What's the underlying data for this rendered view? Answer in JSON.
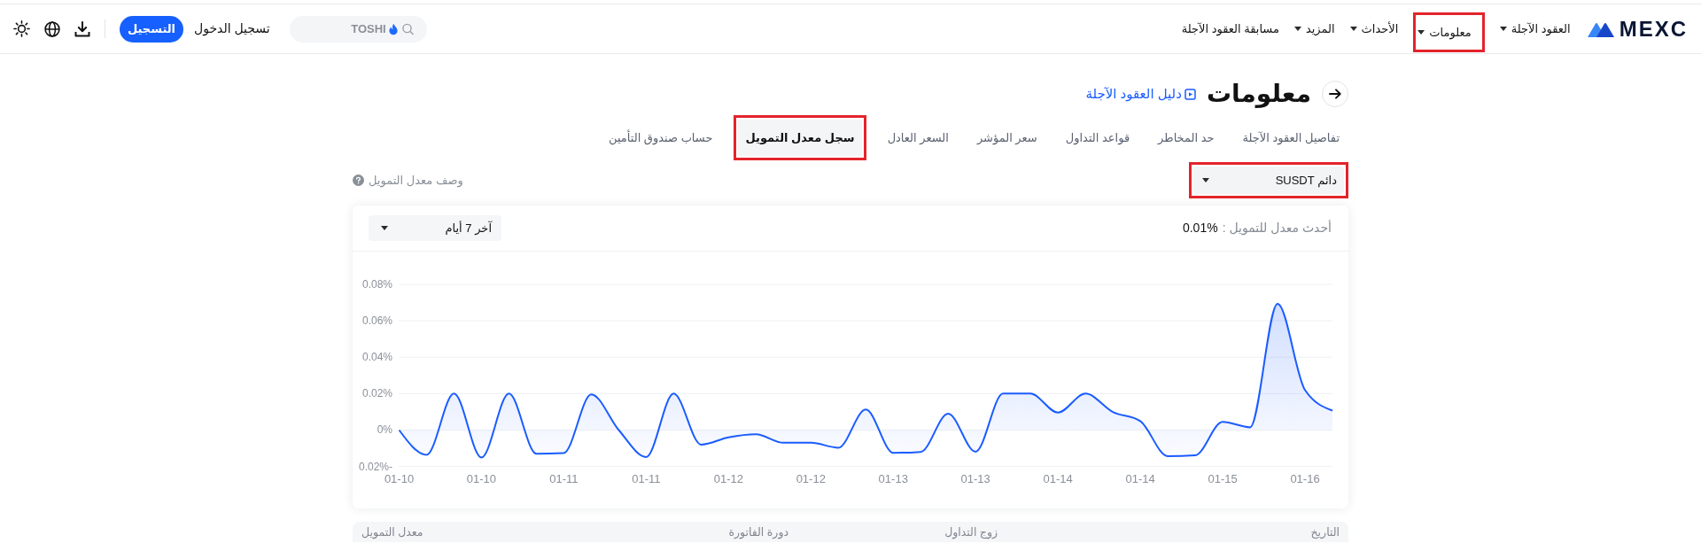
{
  "header": {
    "brand": "MEXC",
    "nav": [
      {
        "label": "العقود الآجلة",
        "has_menu": true,
        "highlighted": false
      },
      {
        "label": "معلومات",
        "has_menu": true,
        "highlighted": true
      },
      {
        "label": "الأحداث",
        "has_menu": true,
        "highlighted": false
      },
      {
        "label": "المزيد",
        "has_menu": true,
        "highlighted": false
      },
      {
        "label": "مسابقة العقود الآجلة",
        "has_menu": false,
        "highlighted": false
      }
    ],
    "search": {
      "placeholder": "TOSHI"
    },
    "login": "تسجيل الدخول",
    "register": "التسجيل"
  },
  "page": {
    "title": "معلومات",
    "guide_link": "دليل العقود الآجلة"
  },
  "tabs": [
    {
      "label": "تفاصيل العقود الآجلة",
      "selected": false,
      "highlighted": false
    },
    {
      "label": "حد المخاطر",
      "selected": false,
      "highlighted": false
    },
    {
      "label": "قواعد التداول",
      "selected": false,
      "highlighted": false
    },
    {
      "label": "سعر المؤشر",
      "selected": false,
      "highlighted": false
    },
    {
      "label": "السعر العادل",
      "selected": false,
      "highlighted": false
    },
    {
      "label": "سجل معدل التمويل",
      "selected": true,
      "highlighted": true
    },
    {
      "label": "حساب صندوق التأمين",
      "selected": false,
      "highlighted": false
    }
  ],
  "contract_select": {
    "value": "دائم SUSDT",
    "highlighted": true
  },
  "funding_description_link": "وصف معدل التمويل",
  "chart_card": {
    "latest_label": "أحدث معدل للتمويل :",
    "latest_value": "0.01%",
    "period_select": "آخر 7 أيام",
    "chart_data": {
      "type": "area",
      "grid": true,
      "categories": [
        "01-10",
        null,
        null,
        "01-10",
        null,
        null,
        "01-11",
        null,
        null,
        "01-11",
        null,
        null,
        "01-12",
        null,
        null,
        "01-12",
        null,
        null,
        "01-13",
        null,
        null,
        "01-13",
        null,
        null,
        "01-14",
        null,
        null,
        "01-14",
        null,
        null,
        "01-15",
        null,
        null,
        "01-16",
        null
      ],
      "ylim": [
        -0.02,
        0.08
      ],
      "yticks": [
        {
          "value": -0.02,
          "label": "-0.02%"
        },
        {
          "value": 0,
          "label": "0%"
        },
        {
          "value": 0.02,
          "label": "0.02%"
        },
        {
          "value": 0.04,
          "label": "0.04%"
        },
        {
          "value": 0.06,
          "label": "0.06%"
        },
        {
          "value": 0.08,
          "label": "0.08%"
        }
      ],
      "series": [
        {
          "color": "#1b5cff",
          "values": [
            0,
            -0.0136,
            0.02,
            -0.0151,
            0.02,
            -0.013,
            -0.0126,
            0.0196,
            0,
            -0.0148,
            0.02,
            -0.008,
            -0.004,
            -0.0023,
            -0.007,
            -0.007,
            -0.0097,
            0.0113,
            -0.0125,
            -0.012,
            0.009,
            -0.0119,
            0.02,
            0.02,
            0.0096,
            0.02,
            0.0099,
            0.0049,
            -0.0144,
            -0.0139,
            0.0045,
            0.0015,
            0.0693,
            0.022,
            0.0107
          ]
        }
      ]
    }
  },
  "table": {
    "columns": [
      "التاريخ",
      "زوج التداول",
      "دورة الفاتورة",
      "معدل التمويل"
    ]
  }
}
